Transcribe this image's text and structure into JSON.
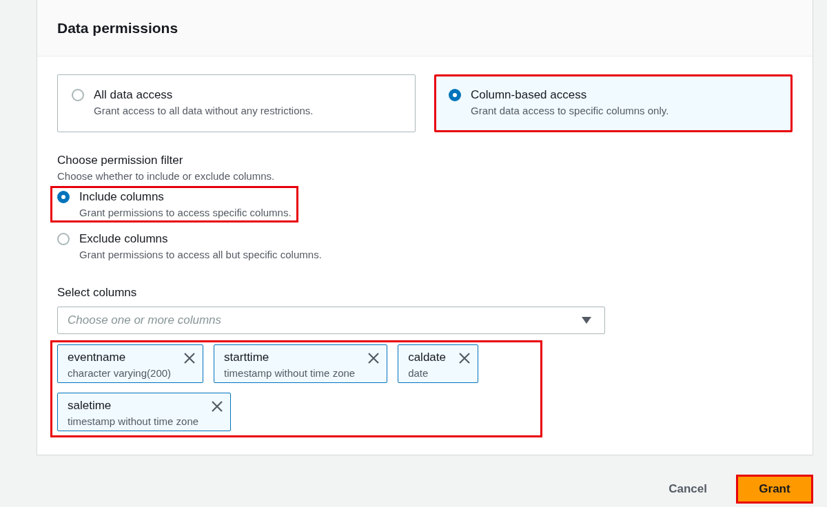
{
  "panel": {
    "title": "Data permissions"
  },
  "access_options": [
    {
      "label": "All data access",
      "description": "Grant access to all data without any restrictions.",
      "selected": false,
      "highlighted": false
    },
    {
      "label": "Column-based access",
      "description": "Grant data access to specific columns only.",
      "selected": true,
      "highlighted": true
    }
  ],
  "permission_filter": {
    "label": "Choose permission filter",
    "description": "Choose whether to include or exclude columns.",
    "options": [
      {
        "label": "Include columns",
        "description": "Grant permissions to access specific columns.",
        "selected": true,
        "highlighted": true
      },
      {
        "label": "Exclude columns",
        "description": "Grant permissions to access all but specific columns.",
        "selected": false,
        "highlighted": false
      }
    ]
  },
  "select_columns": {
    "label": "Select columns",
    "placeholder": "Choose one or more columns",
    "highlighted": true,
    "tokens": [
      {
        "name": "eventname",
        "type": "character varying(200)"
      },
      {
        "name": "starttime",
        "type": "timestamp without time zone"
      },
      {
        "name": "caldate",
        "type": "date"
      },
      {
        "name": "saletime",
        "type": "timestamp without time zone"
      }
    ]
  },
  "buttons": [
    {
      "label": "Cancel",
      "kind": "link",
      "highlighted": false
    },
    {
      "label": "Grant",
      "kind": "primary",
      "highlighted": true
    }
  ]
}
